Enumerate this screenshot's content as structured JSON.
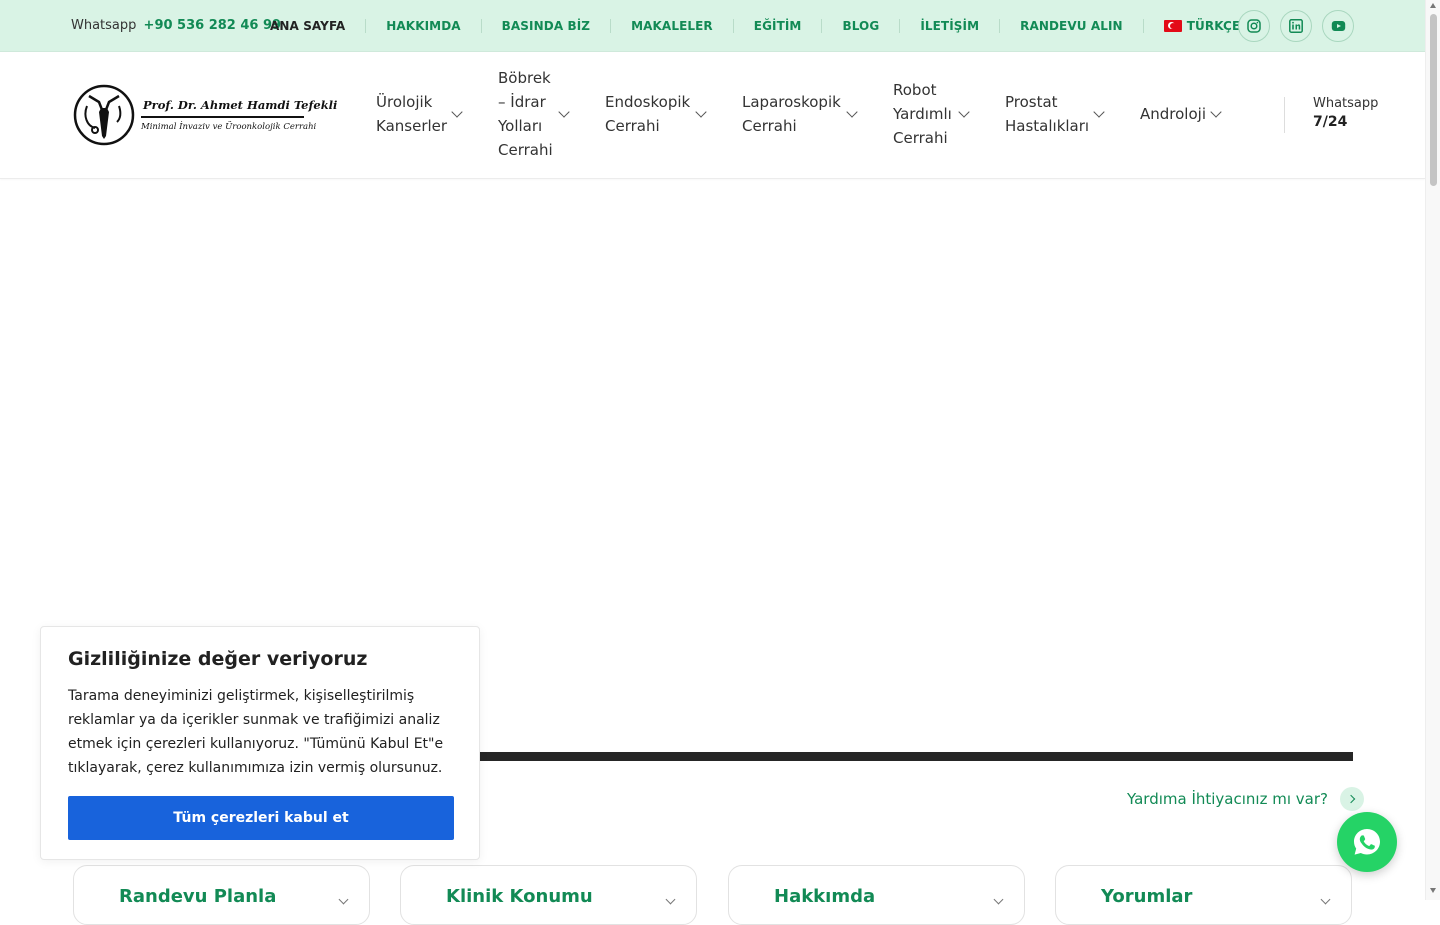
{
  "topbar": {
    "whatsapp_label": "Whatsapp",
    "whatsapp_number": "+90 536 282 46 99",
    "nav": [
      "ANA SAYFA",
      "HAKKIMDA",
      "BASINDA BİZ",
      "MAKALELER",
      "EĞİTİM",
      "BLOG",
      "İLETİŞİM",
      "RANDEVU ALIN"
    ],
    "language": "TÜRKÇE",
    "social_icons": [
      "instagram-icon",
      "linkedin-icon",
      "youtube-icon"
    ]
  },
  "logo": {
    "name": "Prof. Dr. Ahmet Hamdi Tefekli",
    "subtitle": "Minimal İnvaziv ve Üroonkolojik Cerrahi"
  },
  "mainnav": {
    "items": [
      {
        "lines": [
          "Ürolojik",
          "Kanserler"
        ]
      },
      {
        "lines": [
          "Böbrek",
          "– İdrar",
          "Yolları",
          "Cerrahi"
        ]
      },
      {
        "lines": [
          "Endoskopik",
          "Cerrahi"
        ]
      },
      {
        "lines": [
          "Laparoskopik",
          "Cerrahi"
        ]
      },
      {
        "lines": [
          "Robot",
          "Yardımlı",
          "Cerrahi"
        ]
      },
      {
        "lines": [
          "Prostat",
          "Hastalıkları"
        ]
      },
      {
        "lines": [
          "Androloji"
        ]
      }
    ],
    "whatsapp_label": "Whatsapp",
    "whatsapp_hours": "7/24"
  },
  "help": {
    "text": "Yardıma İhtiyacınız mı var?"
  },
  "cards": [
    {
      "title": "Randevu Planla"
    },
    {
      "title": "Klinik Konumu"
    },
    {
      "title": "Hakkımda"
    },
    {
      "title": "Yorumlar"
    }
  ],
  "cookie": {
    "title": "Gizliliğinize değer veriyoruz",
    "body": "Tarama deneyiminizi geliştirmek, kişiselleştirilmiş reklamlar ya da içerikler sunmak ve trafiğimizi analiz etmek için çerezleri kullanıyoruz. \"Tümünü Kabul Et\"e tıklayarak, çerez kullanımımıza izin vermiş olursunuz.",
    "button": "Tüm çerezleri kabul et"
  },
  "colors": {
    "brand_green": "#128a55",
    "topbar_bg": "#d9f3e5",
    "cookie_button": "#1863dc",
    "whatsapp_green": "#25d366"
  }
}
